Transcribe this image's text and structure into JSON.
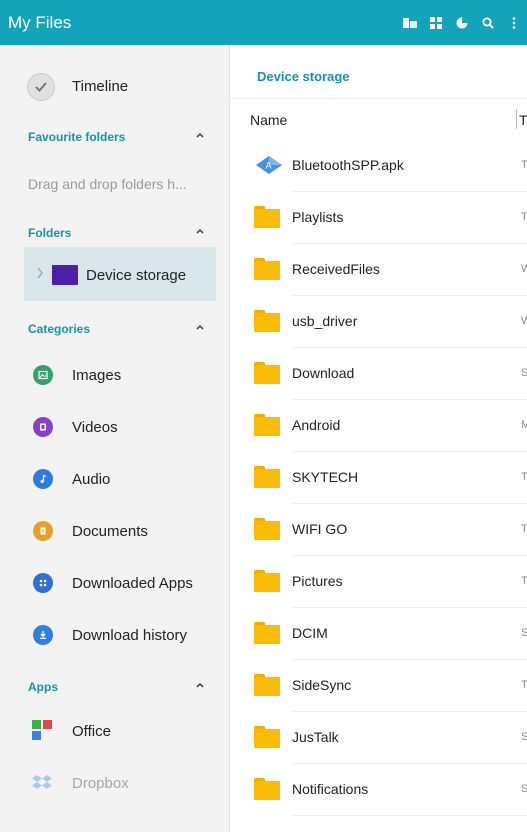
{
  "app": {
    "title": "My Files",
    "bar_color": "#13a4b9",
    "actions": [
      "storage-usage-icon",
      "grid-view-icon",
      "pie-chart-icon",
      "search-icon",
      "more-options-icon"
    ]
  },
  "sidebar": {
    "timeline_label": "Timeline",
    "favourites": {
      "title": "Favourite folders",
      "hint": "Drag and drop folders h..."
    },
    "folders": {
      "title": "Folders",
      "device_storage_label": "Device storage"
    },
    "categories": {
      "title": "Categories",
      "items": [
        {
          "label": "Images",
          "icon": "images-icon",
          "color": "#2fa36b"
        },
        {
          "label": "Videos",
          "icon": "videos-icon",
          "color": "#8a3fc9"
        },
        {
          "label": "Audio",
          "icon": "audio-icon",
          "color": "#2d7be0"
        },
        {
          "label": "Documents",
          "icon": "documents-icon",
          "color": "#e3a12c"
        },
        {
          "label": "Downloaded Apps",
          "icon": "downloaded-apps-icon",
          "color": "#2d6fd6"
        },
        {
          "label": "Download history",
          "icon": "download-history-icon",
          "color": "#2f7fe0"
        }
      ]
    },
    "apps": {
      "title": "Apps",
      "items": [
        {
          "label": "Office",
          "icon": "office-icon"
        },
        {
          "label": "Dropbox",
          "icon": "dropbox-icon"
        }
      ]
    }
  },
  "main": {
    "breadcrumb": "Device storage",
    "columns": {
      "name": "Name",
      "type_initial": "T"
    },
    "files": [
      {
        "name": "BluetoothSPP.apk",
        "kind": "apk",
        "meta": "T"
      },
      {
        "name": "Playlists",
        "kind": "folder",
        "meta": "T"
      },
      {
        "name": "ReceivedFiles",
        "kind": "folder",
        "meta": "W"
      },
      {
        "name": "usb_driver",
        "kind": "folder",
        "meta": "W"
      },
      {
        "name": "Download",
        "kind": "folder",
        "meta": "S"
      },
      {
        "name": "Android",
        "kind": "folder",
        "meta": "M"
      },
      {
        "name": "SKYTECH",
        "kind": "folder",
        "meta": "T"
      },
      {
        "name": "WIFI GO",
        "kind": "folder",
        "meta": "T"
      },
      {
        "name": "Pictures",
        "kind": "folder",
        "meta": "T"
      },
      {
        "name": "DCIM",
        "kind": "folder",
        "meta": "S"
      },
      {
        "name": "SideSync",
        "kind": "folder",
        "meta": "T"
      },
      {
        "name": "JusTalk",
        "kind": "folder",
        "meta": "S"
      },
      {
        "name": "Notifications",
        "kind": "folder",
        "meta": "S"
      }
    ]
  }
}
